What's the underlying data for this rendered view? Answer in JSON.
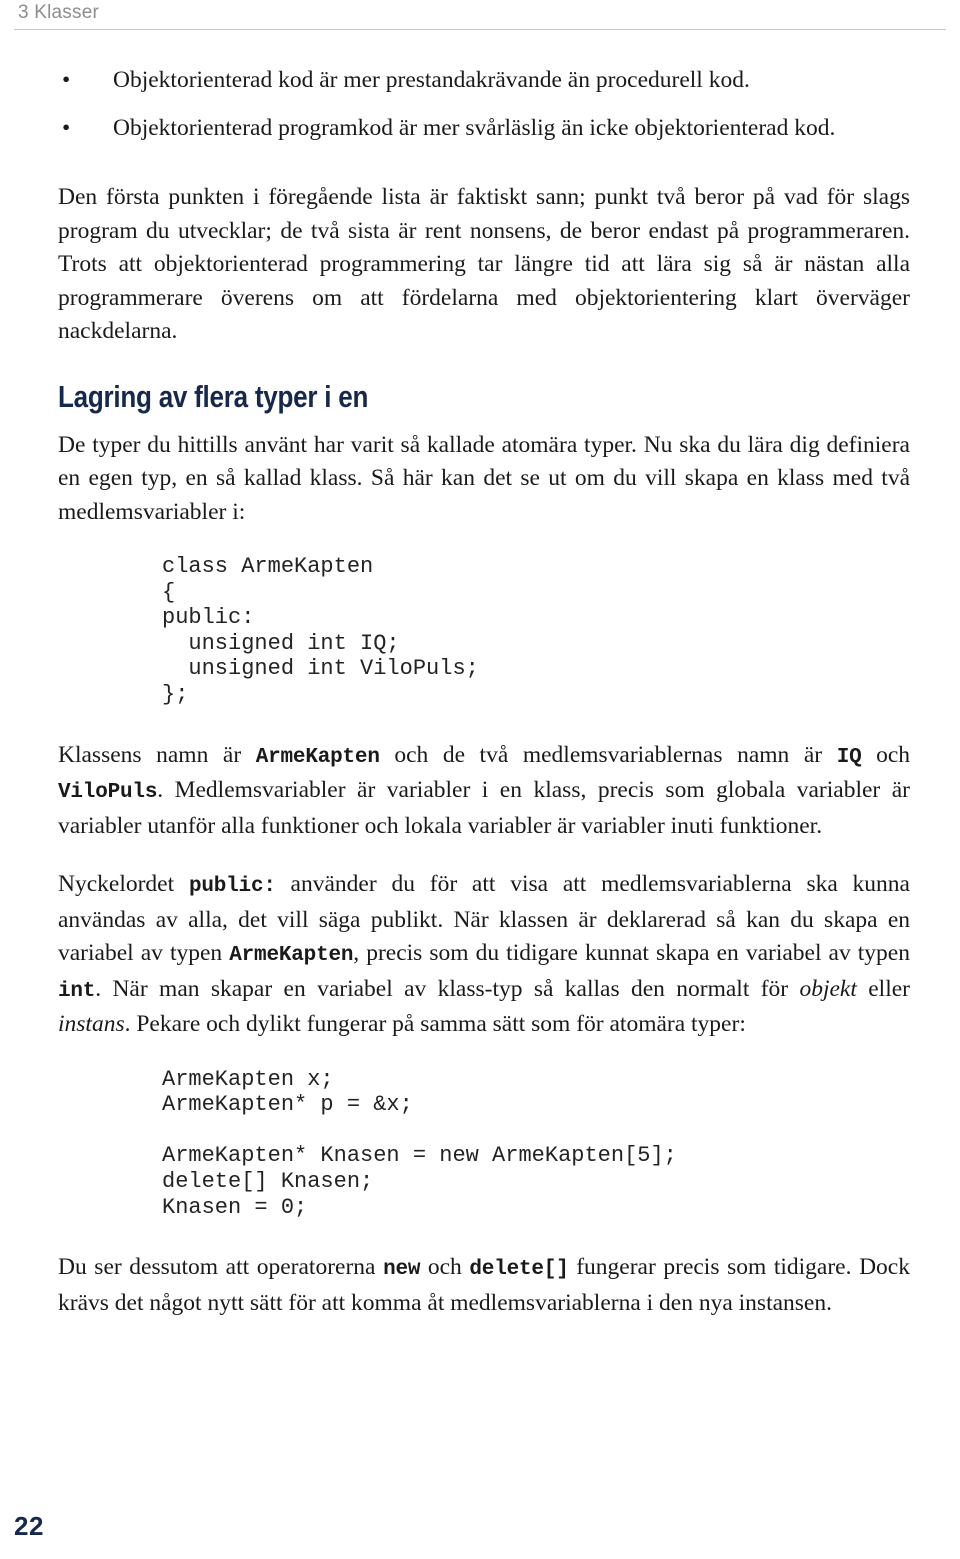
{
  "running_head": {
    "text": "3 Klasser"
  },
  "colors": {
    "heading_navy": "#16284c",
    "running_head_gray": "#8d8d8d",
    "rule_gray": "#c6c6c6",
    "body_text": "#1a1a1a"
  },
  "bullets": [
    "Objektorienterad kod är mer prestandakrävande än procedurell kod.",
    "Objektorienterad programkod är mer svårläslig än icke objektorienterad kod."
  ],
  "paragraph_intro": "Den första punkten i föregående lista är faktiskt sann; punkt två beror på vad för slags program du utvecklar; de två sista är rent nonsens, de beror endast på programmeraren. Trots att objektorienterad programmering tar längre tid att lära sig så är nästan alla programmerare överens om att fördelarna med objektorientering klart överväger nackdelarna.",
  "section": {
    "heading": "Lagring av flera typer i en",
    "paragraph": "De typer du hittills använt har varit så kallade atomära typer. Nu ska du lära dig definiera en egen typ, en så kallad klass. Så här kan det se ut om du vill skapa en klass med två medlemsvariabler i:"
  },
  "code_block_1": "class ArmeKapten\n{\npublic:\n  unsigned int IQ;\n  unsigned int ViloPuls;\n};",
  "paragraph_klassens": {
    "seg1": "Klassens namn är ",
    "code1": "ArmeKapten",
    "seg2": " och de två medlemsvariablernas namn är ",
    "code2": "IQ",
    "seg3": " och ",
    "code3": "ViloPuls",
    "seg4": ". Medlemsvariabler är variabler i en klass, precis som globala variabler är variabler utanför alla funktioner och lokala variabler är variabler inuti funktioner."
  },
  "paragraph_public": {
    "seg1": "Nyckelordet ",
    "code1": "public:",
    "seg2": " använder du för att visa att medlemsvariablerna ska kunna användas av alla, det vill säga publikt. När klassen är deklarerad så kan du skapa en variabel av typen ",
    "code2": "ArmeKapten",
    "seg3": ", precis som du tidigare kunnat skapa en variabel av typen ",
    "code3": "int",
    "seg4": ". När man skapar en variabel av klass-typ så kallas den normalt för ",
    "italic1": "objekt",
    "seg5": " eller ",
    "italic2": "instans",
    "seg6": ". Pekare och dylikt fungerar på samma sätt som för atomära typer:"
  },
  "code_block_2": "ArmeKapten x;\nArmeKapten* p = &x;\n\nArmeKapten* Knasen = new ArmeKapten[5];\ndelete[] Knasen;\nKnasen = 0;",
  "paragraph_operators": {
    "seg1": "Du ser dessutom att operatorerna ",
    "code1": "new",
    "seg2": " och ",
    "code2": "delete[]",
    "seg3": " fungerar precis som tidigare. Dock krävs det något nytt sätt för att komma åt medlemsvariablerna i den nya instansen."
  },
  "folio": "22"
}
